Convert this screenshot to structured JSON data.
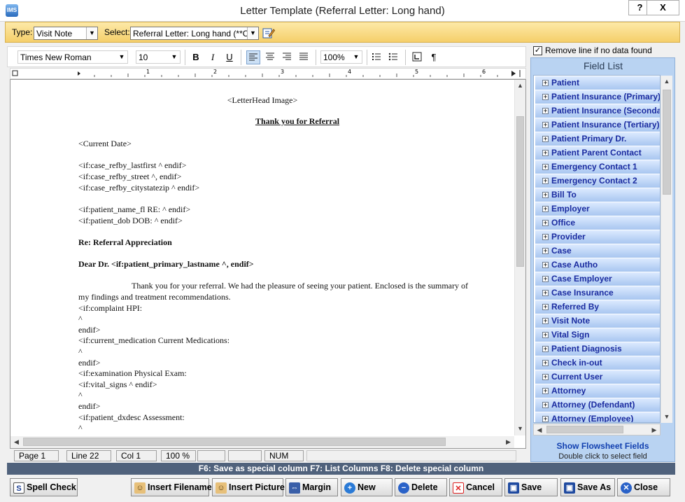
{
  "window": {
    "title": "Letter Template (Referral Letter: Long hand)",
    "help_label": "?",
    "close_label": "X",
    "app_icon_text": "IMS"
  },
  "type_bar": {
    "type_label": "Type:",
    "type_value": "Visit Note",
    "select_label": "Select:",
    "select_value": "Referral Letter: Long hand  (**Con..."
  },
  "format_toolbar": {
    "font": "Times New Roman",
    "size": "10",
    "zoom": "100%",
    "bold": "B",
    "italic": "I",
    "underline": "U",
    "pilcrow": "¶"
  },
  "ruler": {
    "marks": [
      "1",
      "2",
      "3",
      "4",
      "5",
      "6"
    ]
  },
  "document": {
    "lines": [
      "<LetterHead Image>",
      "Thank you for Referral",
      "<Current Date>",
      "<if:case_refby_lastfirst ^ endif>",
      "<if:case_refby_street ^, endif>",
      "<if:case_refby_citystatezip ^ endif>",
      "<if:patient_name_fl RE: ^ endif>",
      "<if:patient_dob DOB: ^ endif>",
      "Re:  Referral Appreciation",
      "Dear Dr. <if:patient_primary_lastname ^, endif>",
      "Thank you for your referral.  We had the pleasure of seeing your patient. Enclosed is the summary of",
      "my findings and treatment recommendations.",
      "<if:complaint HPI:",
      "^",
      " endif>",
      "<if:current_medication Current Medications:",
      "^",
      " endif>",
      "<if:examination Physical Exam:",
      "<if:vital_signs ^ endif>",
      "^",
      " endif>",
      "<if:patient_dxdesc Assessment:",
      "^"
    ]
  },
  "status_bar": {
    "page": "Page   1",
    "line": "Line   22",
    "col": "Col    1",
    "zoom": "100 %",
    "num": "NUM"
  },
  "function_keys": "F6: Save as special column     F7: List Columns     F8: Delete special column",
  "right_panel": {
    "remove_line_label": "Remove line if no data found",
    "field_list_title": "Field List",
    "items": [
      "Patient",
      "Patient Insurance (Primary)",
      "Patient Insurance (Secondary)",
      "Patient Insurance (Tertiary)",
      "Patient Primary Dr.",
      "Patient Parent Contact",
      "Emergency Contact 1",
      "Emergency Contact 2",
      "Bill To",
      "Employer",
      "Office",
      "Provider",
      "Case",
      "Case Autho",
      "Case Employer",
      "Case Insurance",
      "Referred By",
      "Visit Note",
      "Vital Sign",
      "Patient Diagnosis",
      "Check in-out",
      "Current User",
      "Attorney",
      "Attorney (Defendant)",
      "Attorney (Employee)"
    ],
    "show_flowsheet": "Show Flowsheet Fields",
    "double_click_hint": "Double click to select field"
  },
  "buttons": {
    "spell_check": "Spell Check",
    "insert_filename": "Insert Filename",
    "insert_picture": "Insert Picture",
    "margin": "Margin",
    "new": "New",
    "delete": "Delete",
    "cancel": "Cancel",
    "save": "Save",
    "save_as": "Save As",
    "close": "Close"
  }
}
